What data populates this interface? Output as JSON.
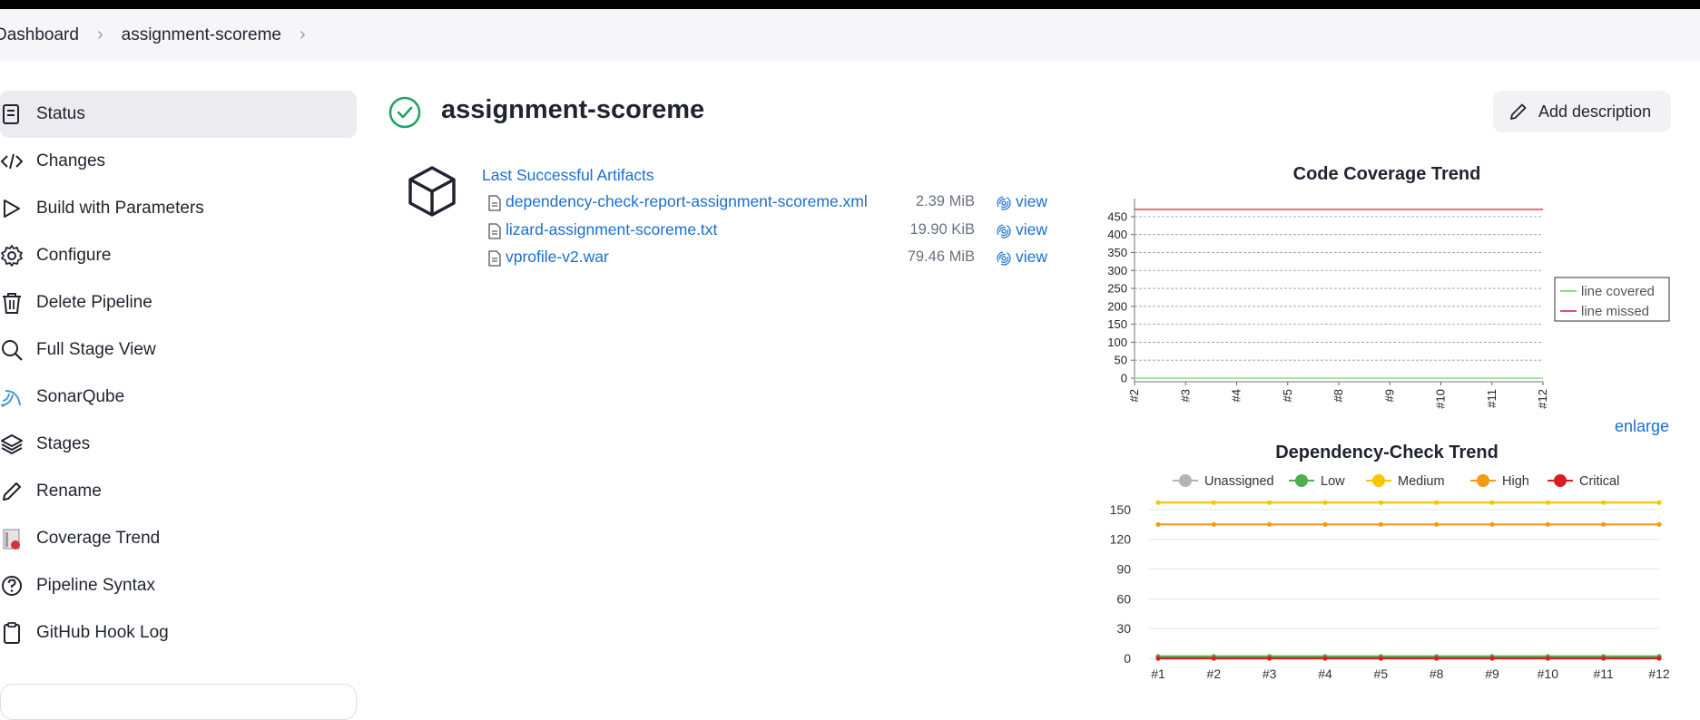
{
  "breadcrumb": {
    "items": [
      "Dashboard",
      "assignment-scoreme"
    ]
  },
  "sidebar": {
    "items": [
      {
        "label": "Status",
        "icon": "status-icon",
        "active": true
      },
      {
        "label": "Changes",
        "icon": "code-icon"
      },
      {
        "label": "Build with Parameters",
        "icon": "play-icon"
      },
      {
        "label": "Configure",
        "icon": "gear-icon"
      },
      {
        "label": "Delete Pipeline",
        "icon": "trash-icon"
      },
      {
        "label": "Full Stage View",
        "icon": "search-icon"
      },
      {
        "label": "SonarQube",
        "icon": "sonarqube-icon"
      },
      {
        "label": "Stages",
        "icon": "layers-icon"
      },
      {
        "label": "Rename",
        "icon": "pencil-icon"
      },
      {
        "label": "Coverage Trend",
        "icon": "coverage-trend-icon"
      },
      {
        "label": "Pipeline Syntax",
        "icon": "help-circle-icon"
      },
      {
        "label": "GitHub Hook Log",
        "icon": "clipboard-icon"
      }
    ]
  },
  "header": {
    "title": "assignment-scoreme",
    "status": "success",
    "add_description": "Add description"
  },
  "artifacts": {
    "heading": "Last Successful Artifacts",
    "files": [
      {
        "name": "dependency-check-report-assignment-scoreme.xml",
        "size": "2.39 MiB",
        "action": "view"
      },
      {
        "name": "lizard-assignment-scoreme.txt",
        "size": "19.90 KiB",
        "action": "view"
      },
      {
        "name": "vprofile-v2.war",
        "size": "79.46 MiB",
        "action": "view"
      }
    ]
  },
  "enlarge_label": "enlarge",
  "chart_data": [
    {
      "type": "line",
      "title": "Code Coverage Trend",
      "categories": [
        "#2",
        "#3",
        "#4",
        "#5",
        "#8",
        "#9",
        "#10",
        "#11",
        "#12"
      ],
      "ylim": [
        0,
        480
      ],
      "yticks": [
        0,
        50,
        100,
        150,
        200,
        250,
        300,
        350,
        400,
        450
      ],
      "grid": true,
      "legend_position": "right",
      "series": [
        {
          "name": "line covered",
          "color": "#7ee07e",
          "values": [
            0,
            0,
            0,
            0,
            0,
            0,
            0,
            0,
            0
          ]
        },
        {
          "name": "line missed",
          "color": "#e8505b",
          "values": [
            470,
            470,
            470,
            470,
            470,
            470,
            470,
            470,
            470
          ]
        }
      ]
    },
    {
      "type": "line",
      "title": "Dependency-Check Trend",
      "categories": [
        "#1",
        "#2",
        "#3",
        "#4",
        "#5",
        "#8",
        "#9",
        "#10",
        "#11",
        "#12"
      ],
      "ylim": [
        0,
        170
      ],
      "yticks": [
        0,
        30,
        60,
        90,
        120,
        150
      ],
      "grid": true,
      "legend_position": "top",
      "series": [
        {
          "name": "Unassigned",
          "color": "#b4b4b4",
          "values": [
            0,
            0,
            0,
            0,
            0,
            0,
            0,
            0,
            0,
            0
          ]
        },
        {
          "name": "Low",
          "color": "#4caf50",
          "values": [
            2,
            2,
            2,
            2,
            2,
            2,
            2,
            2,
            2,
            2
          ]
        },
        {
          "name": "Medium",
          "color": "#f7c600",
          "values": [
            157,
            157,
            157,
            157,
            157,
            157,
            157,
            157,
            157,
            157
          ]
        },
        {
          "name": "High",
          "color": "#f59a14",
          "values": [
            135,
            135,
            135,
            135,
            135,
            135,
            135,
            135,
            135,
            135
          ]
        },
        {
          "name": "Critical",
          "color": "#d81e1e",
          "values": [
            0,
            0,
            0,
            0,
            0,
            0,
            0,
            0,
            0,
            0
          ]
        }
      ]
    }
  ]
}
